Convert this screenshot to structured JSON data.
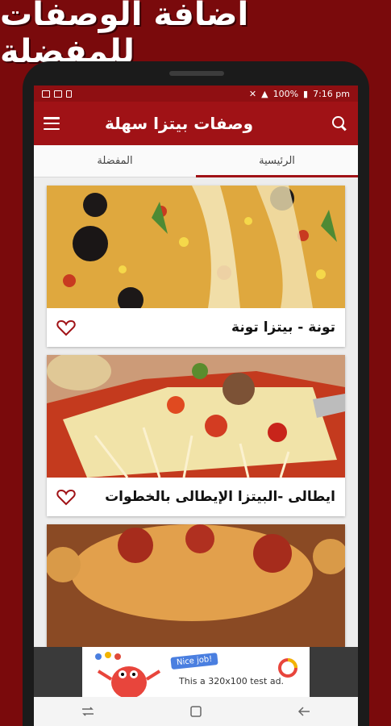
{
  "banner": {
    "text": "اضافة الوصفات للمفضلة"
  },
  "status_bar": {
    "battery": "100%",
    "time": "7:16 pm"
  },
  "app_bar": {
    "title": "وصفات بيتزا سهلة"
  },
  "tabs": [
    {
      "label": "المفضلة",
      "active": false
    },
    {
      "label": "الرئيسية",
      "active": true
    }
  ],
  "recipes": [
    {
      "title": "تونة - بيتزا تونة",
      "favorited": false
    },
    {
      "title": "ايطالى -البيتزا الإيطالى بالخطوات",
      "favorited": false
    },
    {
      "title": "",
      "favorited": false
    }
  ],
  "ad": {
    "badge": "Nice job!",
    "text": "This a 320x100 test ad."
  },
  "colors": {
    "brand": "#a01216",
    "status": "#8f0f12",
    "background": "#7a0a0c"
  }
}
